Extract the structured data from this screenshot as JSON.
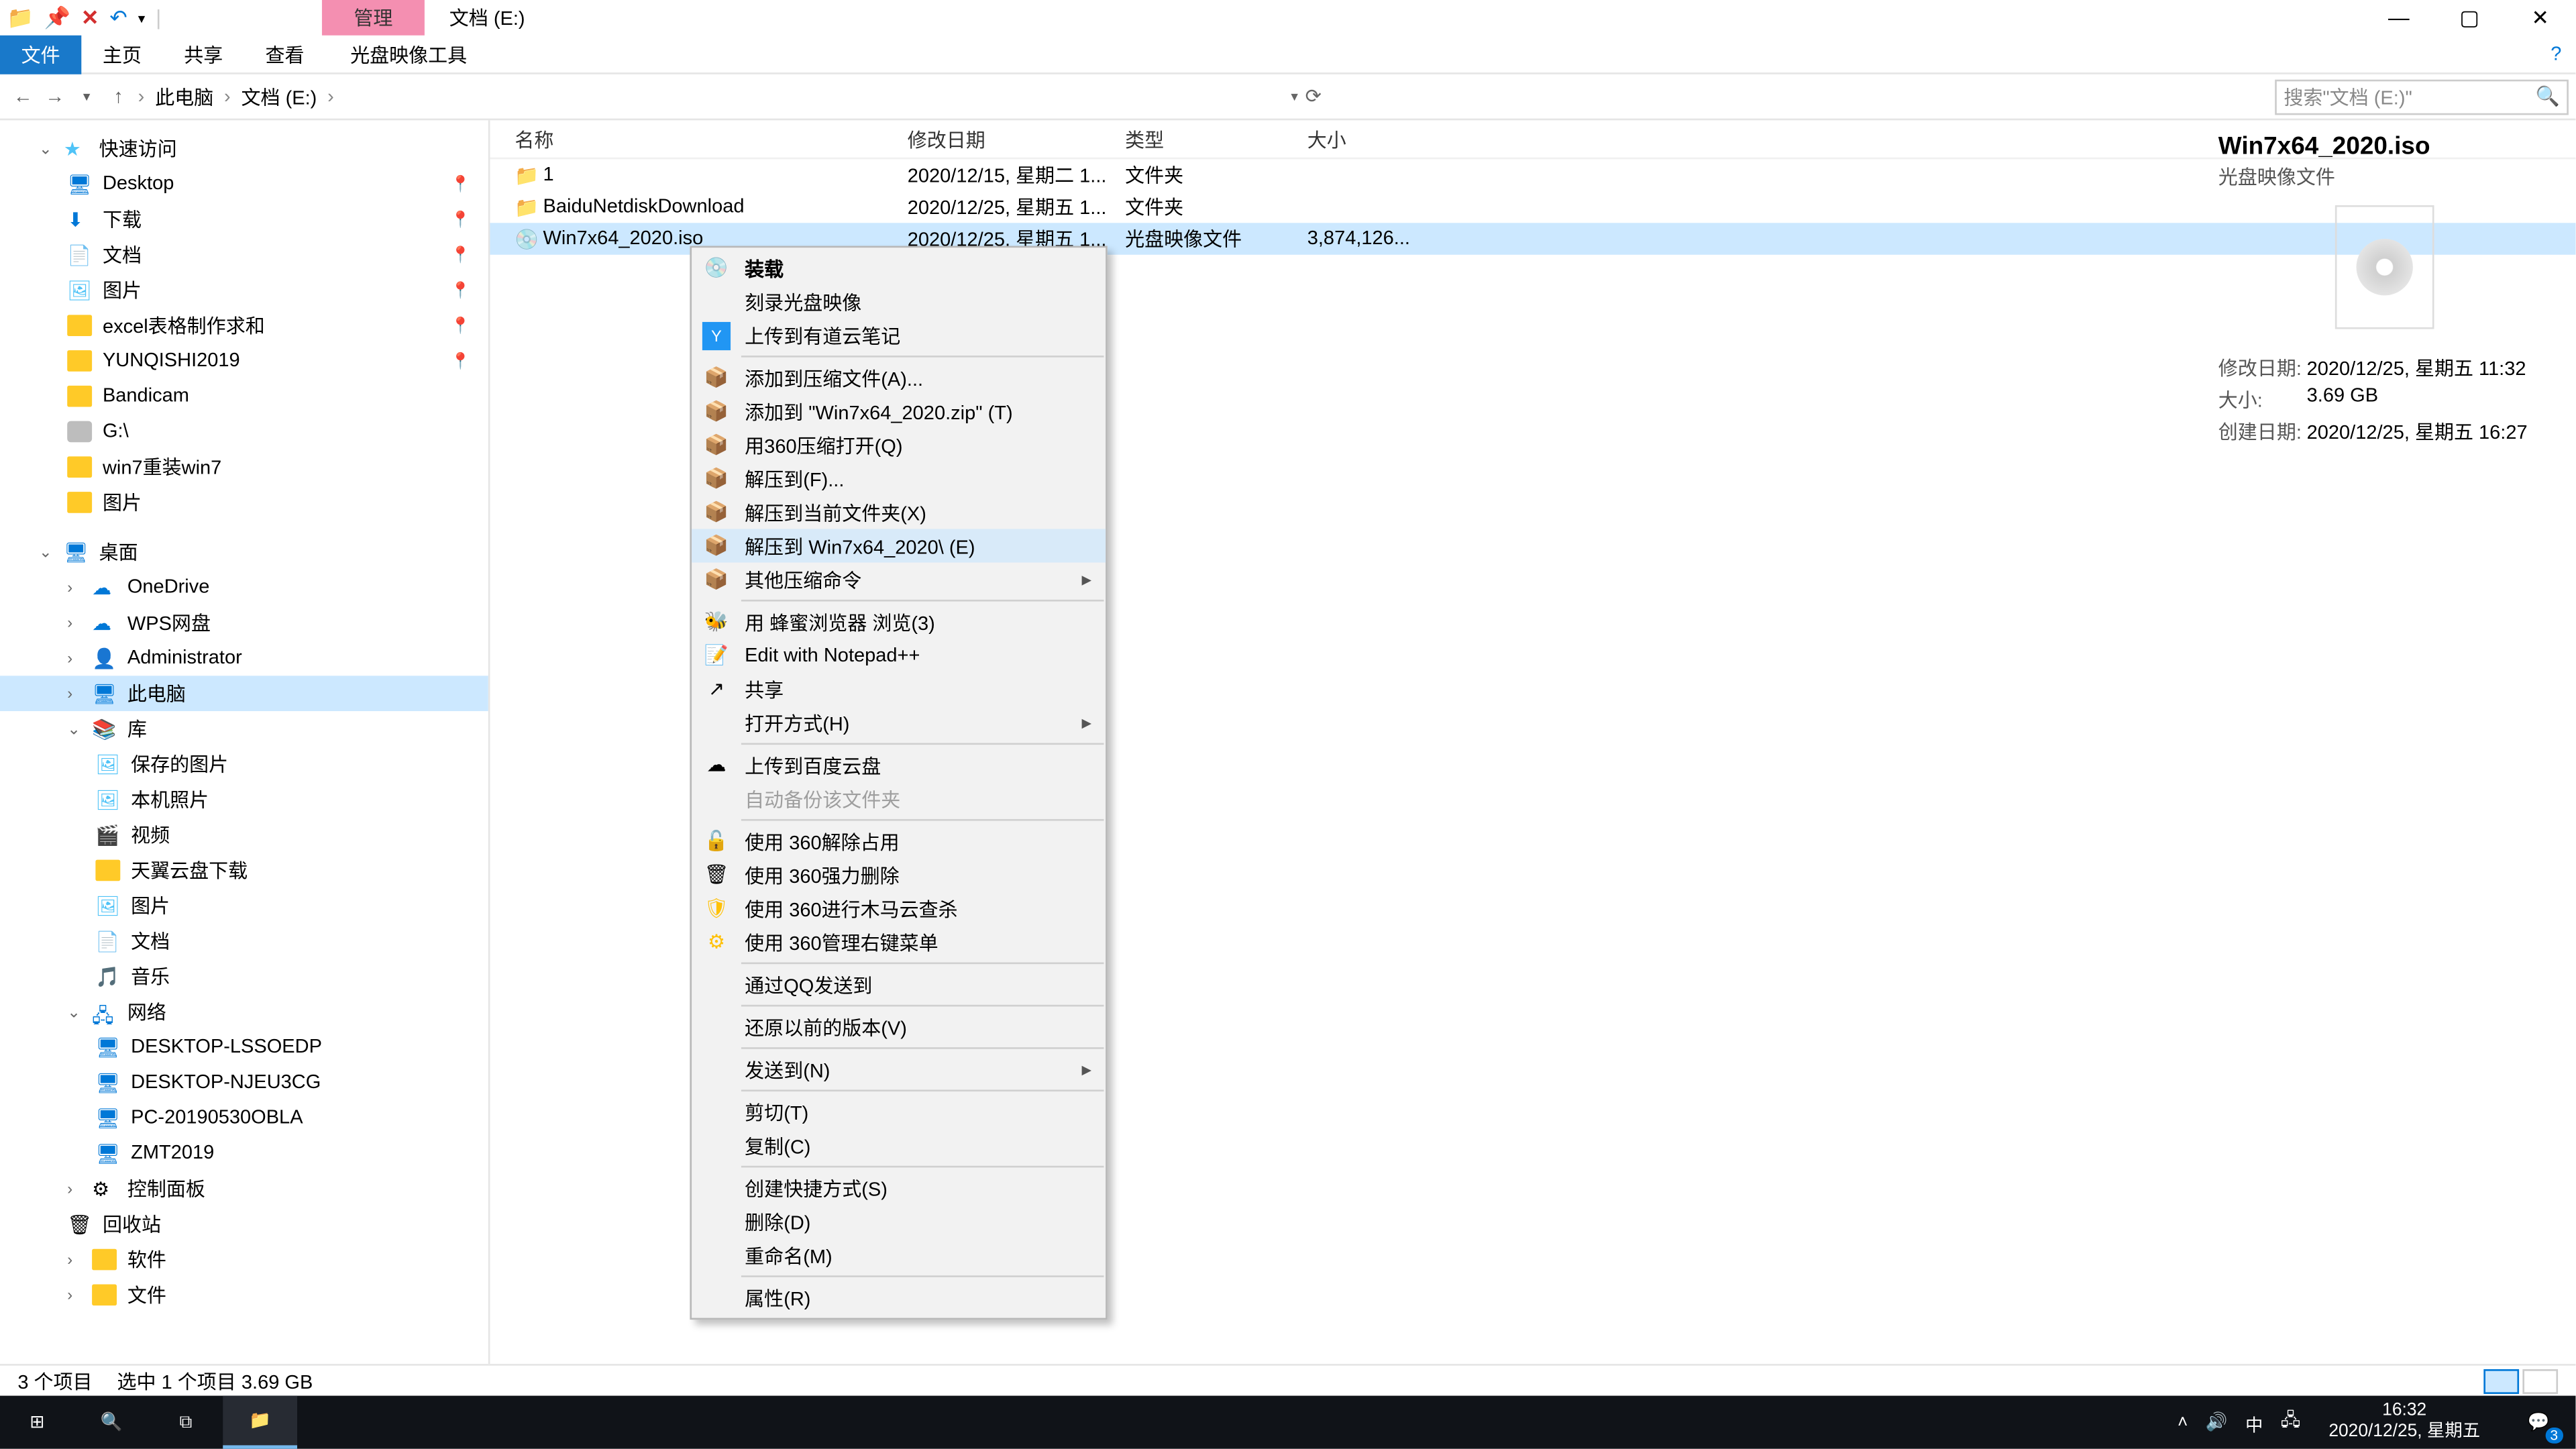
{
  "qat": {
    "manage": "管理",
    "title": "文档 (E:)"
  },
  "ribbon": {
    "file": "文件",
    "home": "主页",
    "share": "共享",
    "view": "查看",
    "ctx": "光盘映像工具"
  },
  "breadcrumb": {
    "pc": "此电脑",
    "loc": "文档 (E:)"
  },
  "search_placeholder": "搜索\"文档 (E:)\"",
  "nav": {
    "quick": "快速访问",
    "desktop": "Desktop",
    "downloads": "下载",
    "docs": "文档",
    "pics": "图片",
    "excel": "excel表格制作求和",
    "yunqishi": "YUNQISHI2019",
    "bandicam": "Bandicam",
    "gdrive": "G:\\",
    "win7r": "win7重装win7",
    "pics2": "图片",
    "desk": "桌面",
    "onedrive": "OneDrive",
    "wps": "WPS网盘",
    "admin": "Administrator",
    "thispc": "此电脑",
    "lib": "库",
    "saved": "保存的图片",
    "localpic": "本机照片",
    "video": "视频",
    "tianyi": "天翼云盘下载",
    "pic3": "图片",
    "doc2": "文档",
    "music": "音乐",
    "network": "网络",
    "d1": "DESKTOP-LSSOEDP",
    "d2": "DESKTOP-NJEU3CG",
    "d3": "PC-20190530OBLA",
    "d4": "ZMT2019",
    "cpanel": "控制面板",
    "recycle": "回收站",
    "soft": "软件",
    "file": "文件"
  },
  "cols": {
    "name": "名称",
    "date": "修改日期",
    "type": "类型",
    "size": "大小"
  },
  "rows": [
    {
      "name": "1",
      "date": "2020/12/15, 星期二 1...",
      "type": "文件夹",
      "size": ""
    },
    {
      "name": "BaiduNetdiskDownload",
      "date": "2020/12/25, 星期五 1...",
      "type": "文件夹",
      "size": ""
    },
    {
      "name": "Win7x64_2020.iso",
      "date": "2020/12/25, 星期五 1...",
      "type": "光盘映像文件",
      "size": "3,874,126..."
    }
  ],
  "menu": {
    "mount": "装载",
    "burn": "刻录光盘映像",
    "youdao": "上传到有道云笔记",
    "addarc": "添加到压缩文件(A)...",
    "addzip": "添加到 \"Win7x64_2020.zip\" (T)",
    "open360": "用360压缩打开(Q)",
    "extractto": "解压到(F)...",
    "extracthere": "解压到当前文件夹(X)",
    "extractfolder": "解压到 Win7x64_2020\\ (E)",
    "othercomp": "其他压缩命令",
    "bee": "用 蜂蜜浏览器 浏览(3)",
    "npp": "Edit with Notepad++",
    "share": "共享",
    "openwith": "打开方式(H)",
    "baidu": "上传到百度云盘",
    "autobak": "自动备份该文件夹",
    "unlock": "使用 360解除占用",
    "forcedel": "使用 360强力删除",
    "scan": "使用 360进行木马云查杀",
    "manage360": "使用 360管理右键菜单",
    "qqsend": "通过QQ发送到",
    "restore": "还原以前的版本(V)",
    "sendto": "发送到(N)",
    "cut": "剪切(T)",
    "copy": "复制(C)",
    "shortcut": "创建快捷方式(S)",
    "delete": "删除(D)",
    "rename": "重命名(M)",
    "props": "属性(R)"
  },
  "details": {
    "title": "Win7x64_2020.iso",
    "sub": "光盘映像文件",
    "m1k": "修改日期:",
    "m1v": "2020/12/25, 星期五 11:32",
    "m2k": "大小:",
    "m2v": "3.69 GB",
    "m3k": "创建日期:",
    "m3v": "2020/12/25, 星期五 16:27"
  },
  "status": {
    "count": "3 个项目",
    "sel": "选中 1 个项目  3.69 GB"
  },
  "taskbar": {
    "ime": "中",
    "time": "16:32",
    "date": "2020/12/25, 星期五",
    "badge": "3"
  }
}
